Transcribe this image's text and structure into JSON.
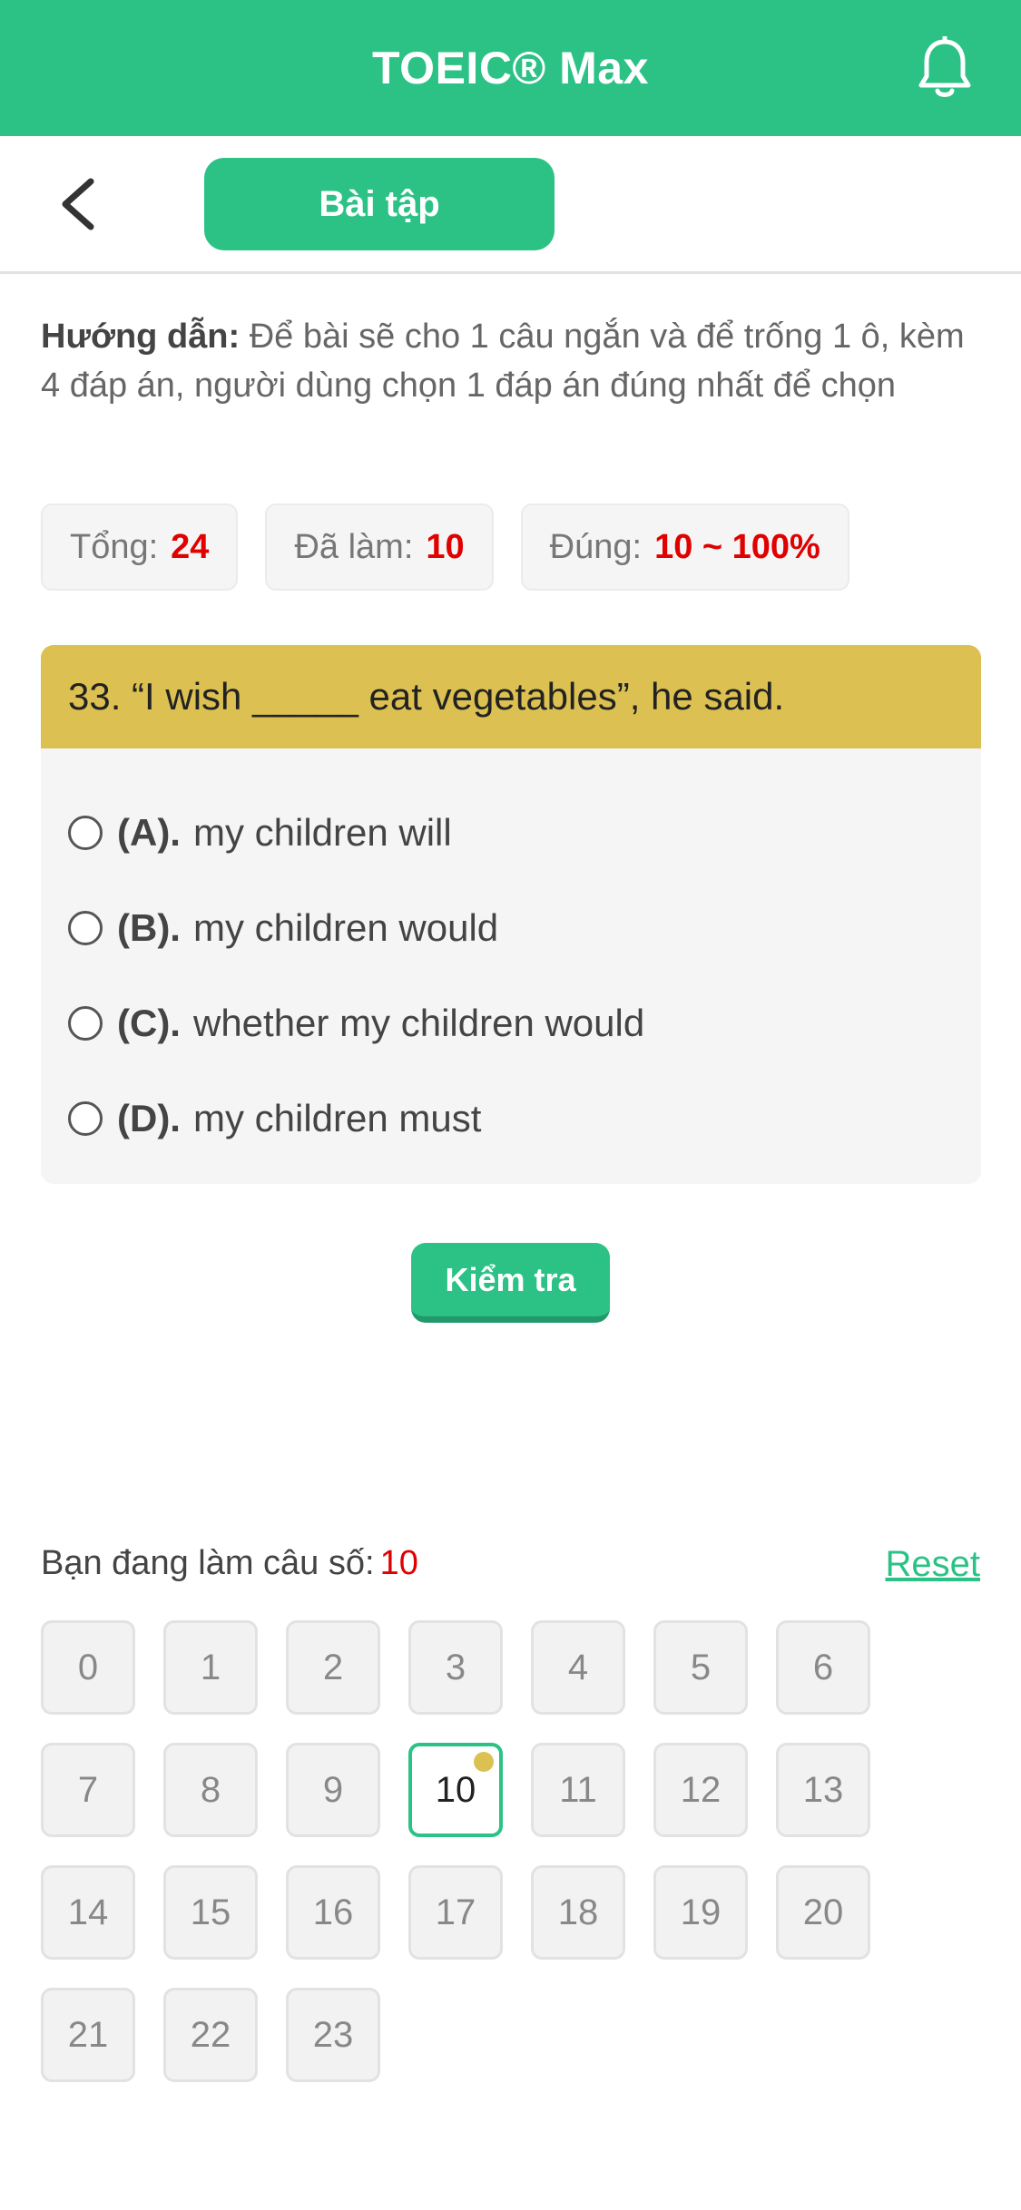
{
  "header": {
    "title": "TOEIC® Max",
    "icon": "bell-icon"
  },
  "nav": {
    "back_icon": "chevron-left-icon",
    "tab_label": "Bài tập"
  },
  "instruction": {
    "label": "Hướng dẫn:",
    "text": " Để bài sẽ cho 1 câu ngắn và để trống 1 ô, kèm 4 đáp án, người dùng chọn 1 đáp án đúng nhất để chọn"
  },
  "stats": {
    "total_label": "Tổng:",
    "total_value": "24",
    "done_label": "Đã làm:",
    "done_value": "10",
    "correct_label": "Đúng:",
    "correct_value": "10 ~ 100%"
  },
  "question": {
    "text": "33. “I wish _____ eat vegetables”, he said.",
    "options": [
      {
        "label": "(A).",
        "text": "my children will"
      },
      {
        "label": "(B).",
        "text": "my children would"
      },
      {
        "label": "(C).",
        "text": "whether my children would"
      },
      {
        "label": "(D).",
        "text": "my children must"
      }
    ]
  },
  "check_button": "Kiểm tra",
  "progress": {
    "current_label": "Bạn đang làm câu số:",
    "current_value": "10",
    "reset_label": "Reset",
    "numbers": [
      "0",
      "1",
      "2",
      "3",
      "4",
      "5",
      "6",
      "7",
      "8",
      "9",
      "10",
      "11",
      "12",
      "13",
      "14",
      "15",
      "16",
      "17",
      "18",
      "19",
      "20",
      "21",
      "22",
      "23"
    ],
    "active": "10"
  },
  "colors": {
    "primary": "#2cc286",
    "question_header": "#dcc152",
    "highlight_red": "#e00000"
  }
}
